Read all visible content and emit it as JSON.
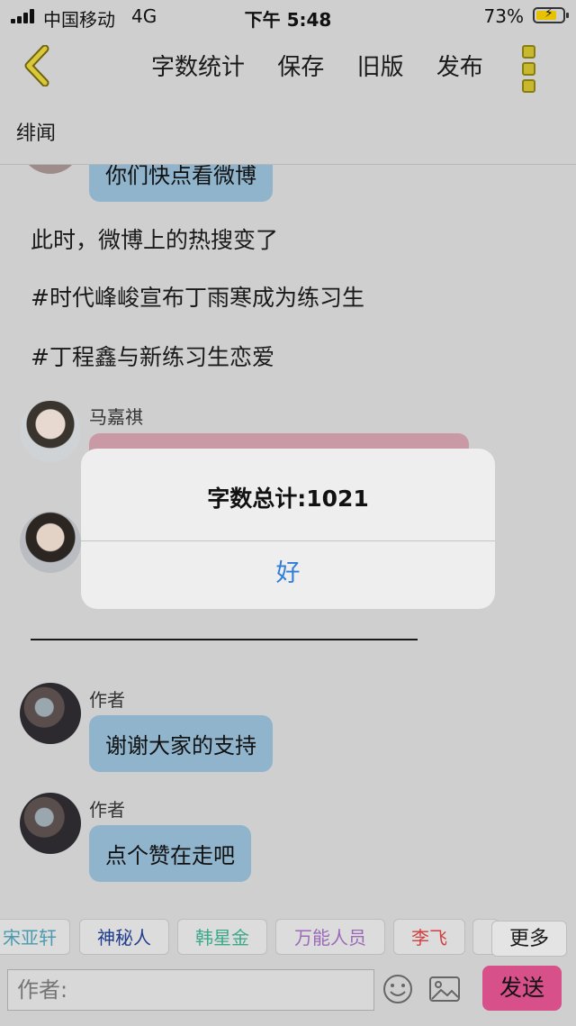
{
  "status_bar": {
    "carrier": "中国移动",
    "network": "4G",
    "time": "下午 5:48",
    "battery": "73%"
  },
  "nav": {
    "items": [
      "字数统计",
      "保存",
      "旧版",
      "发布"
    ],
    "back_icon": "chevron-left-icon",
    "more_icon": "vertical-dots-icon"
  },
  "subtitle": "绯闻",
  "messages": {
    "partial_bubble": "你们快点看微博",
    "narration": [
      "此时，微博上的热搜变了",
      "#时代峰峻宣布丁雨寒成为练习生",
      "#丁程鑫与新练习生恋爱"
    ],
    "speaker1": "马嘉祺",
    "author1": {
      "name": "作者",
      "text": "谢谢大家的支持"
    },
    "author2": {
      "name": "作者",
      "text": "点个赞在走吧"
    }
  },
  "dialog": {
    "message": "字数总计:1021",
    "ok": "好"
  },
  "chips": [
    {
      "label": "宋亚轩",
      "color": "#4a9bb0"
    },
    {
      "label": "神秘人",
      "color": "#1f3d8a"
    },
    {
      "label": "韩星金",
      "color": "#3ba88a"
    },
    {
      "label": "万能人员",
      "color": "#9a6ab8"
    },
    {
      "label": "李飞",
      "color": "#d04040"
    }
  ],
  "chip_more": "更多",
  "composer": {
    "placeholder": "作者:",
    "send": "发送"
  },
  "colors": {
    "bubble": "#8fb4cc",
    "pink_bubble": "#c99aa6",
    "send": "#d8508a",
    "dialog_link": "#2f7ed8"
  }
}
